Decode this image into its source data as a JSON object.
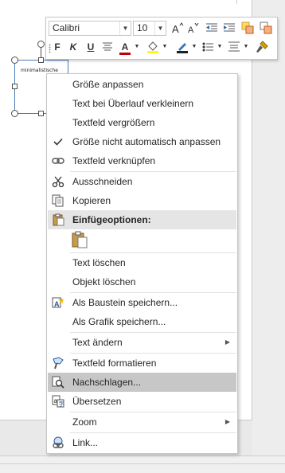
{
  "textbox": {
    "text": "minimalistische"
  },
  "mini_toolbar": {
    "font_name": "Calibri",
    "font_size": "10",
    "buttons_row1": [
      "grow-font",
      "shrink-font",
      "decrease-indent",
      "increase-indent",
      "shape-style",
      "shape-outline"
    ],
    "bold_label": "F",
    "italic_label": "K",
    "underline_label": "U",
    "font_color_label": "A",
    "accent_font_color": "#c00000",
    "accent_fill_color": "#ffff00"
  },
  "context_menu": {
    "items": [
      {
        "label": "Größe anpassen",
        "icon": "none"
      },
      {
        "label": "Text bei Überlauf verkleinern",
        "icon": "none"
      },
      {
        "label": "Textfeld vergrößern",
        "icon": "none"
      },
      {
        "label": "Größe nicht automatisch anpassen",
        "icon": "checkmark-icon"
      },
      {
        "label": "Textfeld verknüpfen",
        "icon": "link-icon"
      },
      {
        "label": "Ausschneiden",
        "icon": "scissors-icon"
      },
      {
        "label": "Kopieren",
        "icon": "copy-icon"
      },
      {
        "label": "Einfügeoptionen:",
        "icon": "paste-icon"
      },
      {
        "label": "Text löschen",
        "icon": "none"
      },
      {
        "label": "Objekt löschen",
        "icon": "none"
      },
      {
        "label": "Als Baustein speichern...",
        "icon": "building-block-icon"
      },
      {
        "label": "Als Grafik speichern...",
        "icon": "none"
      },
      {
        "label": "Text ändern",
        "icon": "none"
      },
      {
        "label": "Textfeld formatieren",
        "icon": "format-icon"
      },
      {
        "label": "Nachschlagen...",
        "icon": "research-icon"
      },
      {
        "label": "Übersetzen",
        "icon": "translate-icon"
      },
      {
        "label": "Zoom",
        "icon": "none"
      },
      {
        "label": "Link...",
        "icon": "hyperlink-icon"
      }
    ],
    "highlighted_item": "Nachschlagen..."
  }
}
